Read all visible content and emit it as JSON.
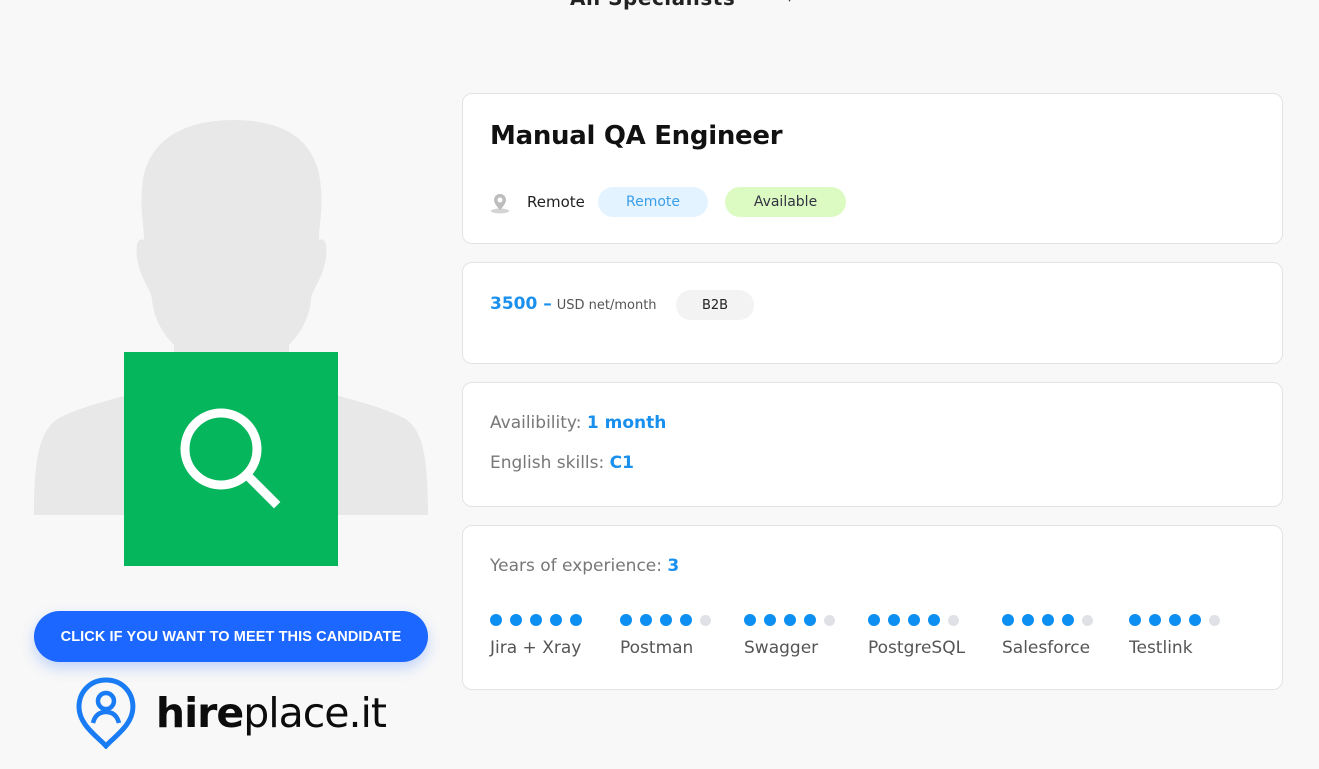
{
  "header": {
    "partial_text": "All Specialists",
    "arrow": "▾"
  },
  "profile": {
    "meet_button": "CLICK IF YOU WANT TO MEET THIS CANDIDATE",
    "logo": {
      "hire": "hire",
      "place": "place.it"
    }
  },
  "job": {
    "title": "Manual QA Engineer",
    "location": "Remote",
    "tags": {
      "remote": "Remote",
      "available": "Available"
    }
  },
  "salary": {
    "value": "3500 –",
    "unit": "USD net/month",
    "contract": "B2B"
  },
  "details": {
    "availability_label": "Availibility:",
    "availability_value": "1 month",
    "english_label": "English skills:",
    "english_value": "C1"
  },
  "experience": {
    "label": "Years of experience:",
    "value": "3",
    "skills": [
      {
        "name": "Jira + Xray",
        "level": 5
      },
      {
        "name": "Postman",
        "level": 4
      },
      {
        "name": "Swagger",
        "level": 4
      },
      {
        "name": "PostgreSQL",
        "level": 4
      },
      {
        "name": "Salesforce",
        "level": 4
      },
      {
        "name": "Testlink",
        "level": 4
      }
    ],
    "max_level": 5
  },
  "colors": {
    "accent": "#1a90ee",
    "button": "#1c67ff",
    "search_box": "#06b65c",
    "available_bg": "#dcfbc2",
    "remote_bg": "#e3f3ff"
  }
}
